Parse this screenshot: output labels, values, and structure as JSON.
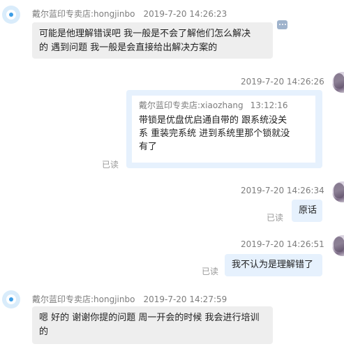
{
  "messages": [
    {
      "sender": "戴尔蓝印专卖店:hongjinbo",
      "time": "2019-7-20 14:26:23",
      "lines": [
        "可能是他理解错误吧   我一般是不会了解他们怎么解决",
        "的  遇到问题 我一般是会直接给出解决方案的"
      ]
    },
    {
      "time": "2019-7-20 14:26:26",
      "quote_sender": "戴尔蓝印专卖店:xiaozhang",
      "quote_time": "13:12:16",
      "quote_lines": [
        "带锁是优盘优启通自带的     跟系统没关",
        "系     重装完系统    进到系统里那个锁就没",
        "有了"
      ],
      "status": "已读"
    },
    {
      "time": "2019-7-20 14:26:34",
      "text": "原话",
      "status": "已读"
    },
    {
      "time": "2019-7-20 14:26:51",
      "text": "我不认为是理解错了",
      "status": "已读"
    },
    {
      "sender": "戴尔蓝印专卖店:hongjinbo",
      "time": "2019-7-20 14:27:59",
      "lines": [
        "嗯 好的 谢谢你提的问题  周一开会的时候 我会进行培训",
        "的"
      ]
    }
  ],
  "icons": {
    "left_avatar": "shop-avatar-icon",
    "right_avatar": "user-avatar-icon",
    "more": "more-options-icon"
  },
  "colors": {
    "incoming_bubble": "#eeeeee",
    "outgoing_bubble": "#e6f1fd",
    "meta_text": "#7d7d7d",
    "avatar_accent": "#3d9de6"
  }
}
